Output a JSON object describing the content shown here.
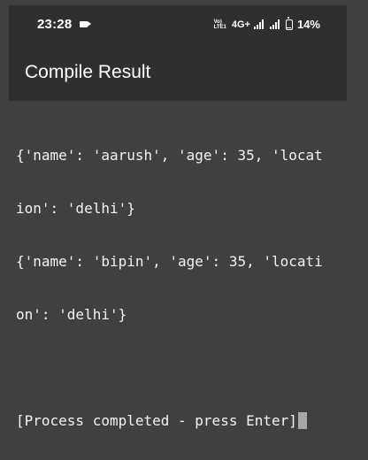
{
  "status_bar": {
    "time": "23:28",
    "volte_top": "Vo)",
    "volte_bottom": "LTE1",
    "network": "4G+",
    "battery": "14%",
    "battery_level": 0.14,
    "icons": [
      "video-icon",
      "volte-icon",
      "signal-icon",
      "signal-icon",
      "battery-icon"
    ]
  },
  "app_bar": {
    "title": "Compile Result"
  },
  "terminal": {
    "lines": [
      "{'name': 'aarush', 'age': 35, 'locat",
      "ion': 'delhi'}",
      "{'name': 'bipin', 'age': 35, 'locati",
      "on': 'delhi'}",
      "",
      "[Process completed - press Enter]"
    ]
  }
}
